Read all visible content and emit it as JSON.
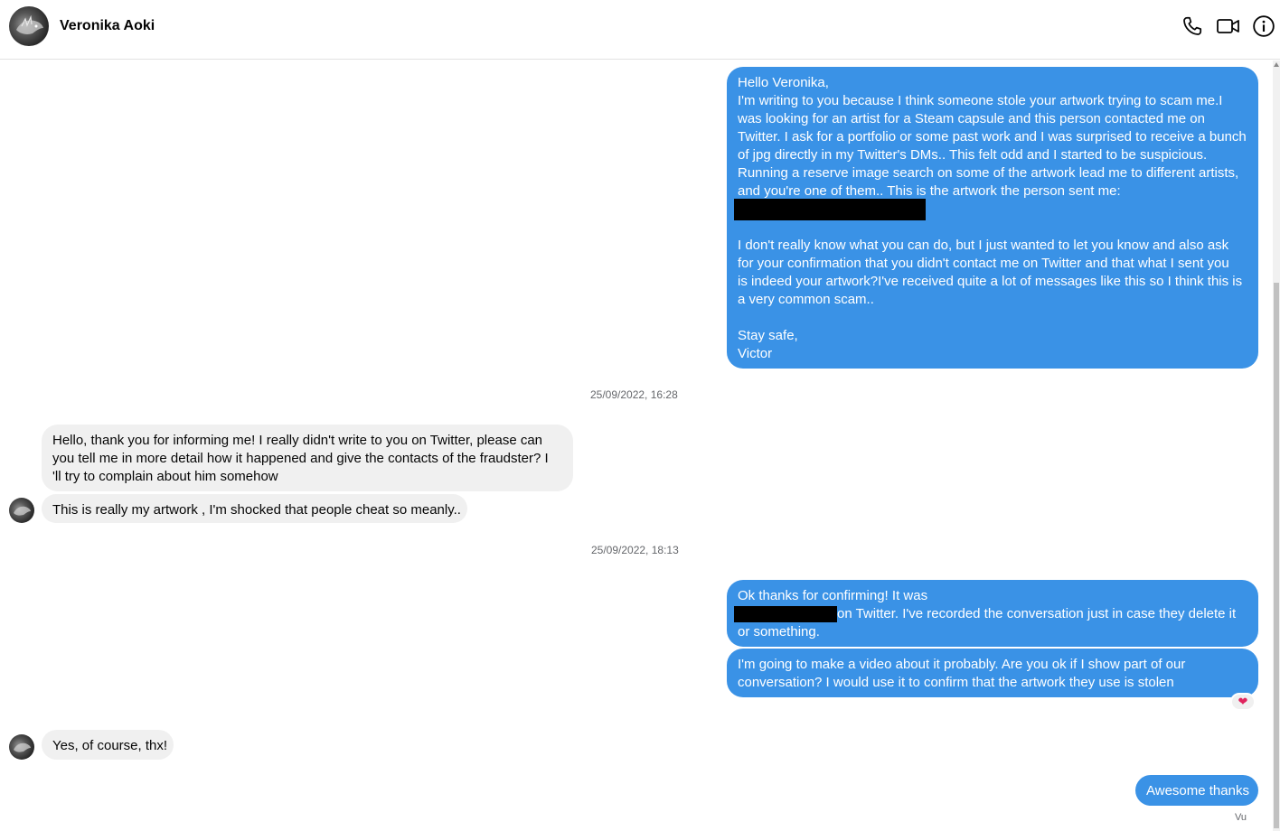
{
  "header": {
    "contact_name": "Veronika Aoki",
    "icons": [
      "phone-icon",
      "video-camera-icon",
      "info-icon"
    ]
  },
  "messages": {
    "m1": {
      "lines": [
        "Hello Veronika,",
        "I'm writing to you because I think someone stole your artwork trying to scam me.I",
        "was looking for an artist for a Steam capsule and this person contacted me on",
        "Twitter. I ask for a portfolio or some past work and I was surprised to receive a bunch",
        "of jpg directly in my Twitter's DMs.. This felt odd and I started to be suspicious.",
        "Running a reserve image search on some of the artwork lead me to different artists,",
        "and you're one of them.. This is the artwork the person sent me:",
        "",
        "",
        "I don't really know what you can do, but I just wanted to let you know and also ask",
        "for your confirmation that you didn't contact me on Twitter and that what I sent you",
        "is indeed your artwork?I've received quite a lot of messages like this so I think this is",
        "a very common scam..",
        "",
        "Stay safe,",
        "Victor"
      ]
    },
    "ts1": "25/09/2022, 16:28",
    "m2": {
      "lines": [
        "Hello, thank you for informing me! I really didn't write to you on Twitter, please can",
        "you tell me in more detail how it happened and give the contacts of the fraudster? I",
        "'ll try to complain about him somehow"
      ]
    },
    "m3": "This is really my artwork , I'm shocked that people cheat so meanly..",
    "ts2": "25/09/2022, 18:13",
    "m4": {
      "line1": "Ok thanks for confirming! It was",
      "line2": "on Twitter. I've recorded the conversation just in case they delete it",
      "line3": "or something."
    },
    "m5": {
      "line1": "I'm going to make a video about it probably. Are you ok if I show part of our",
      "line2": "conversation? I would use it to confirm that the artwork they use is stolen"
    },
    "m5_reaction": "❤",
    "m6": "Yes, of course, thx!",
    "m7": "Awesome thanks",
    "seen_label": "Vu"
  },
  "colors": {
    "outgoing_bubble": "#3a92e6",
    "incoming_bubble": "#f0f0f0",
    "timestamp_text": "#65676b"
  }
}
